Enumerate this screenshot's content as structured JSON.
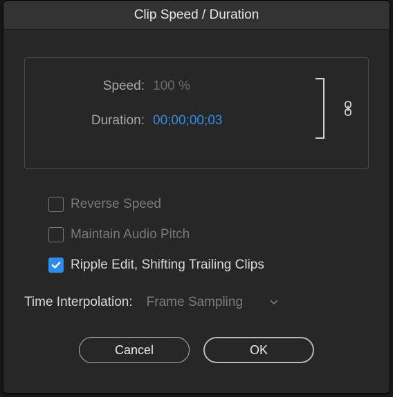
{
  "dialog": {
    "title": "Clip Speed / Duration",
    "speed": {
      "label": "Speed:",
      "value": "100 %",
      "enabled": false
    },
    "duration": {
      "label": "Duration:",
      "value": "00;00;00;03",
      "enabled": true
    },
    "linked": true,
    "checkboxes": {
      "reverse": {
        "label": "Reverse Speed",
        "checked": false,
        "enabled": false
      },
      "maintain_pitch": {
        "label": "Maintain Audio Pitch",
        "checked": false,
        "enabled": false
      },
      "ripple_edit": {
        "label": "Ripple Edit, Shifting Trailing Clips",
        "checked": true,
        "enabled": true
      }
    },
    "time_interpolation": {
      "label": "Time Interpolation:",
      "selected": "Frame Sampling"
    },
    "buttons": {
      "cancel": "Cancel",
      "ok": "OK"
    }
  },
  "colors": {
    "accent": "#2d8ceb",
    "background": "#272727",
    "titlebar": "#323232"
  }
}
